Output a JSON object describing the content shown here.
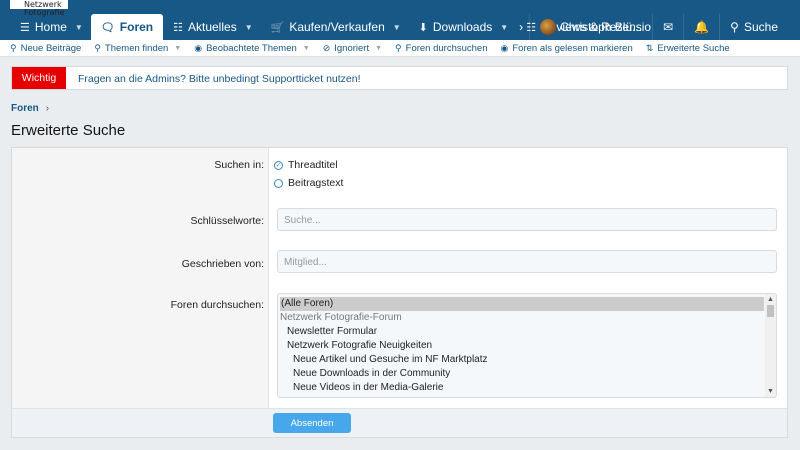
{
  "logo": {
    "text": "Netzwerk Fotografie"
  },
  "nav": {
    "items": [
      {
        "icon": "☰",
        "label": "Home"
      },
      {
        "icon": "🗨",
        "label": "Foren"
      },
      {
        "icon": "☷",
        "label": "Aktuelles"
      },
      {
        "icon": "🛒",
        "label": "Kaufen/Verkaufen"
      },
      {
        "icon": "⬇",
        "label": "Downloads"
      },
      {
        "icon": "☷",
        "label": "Reviews & Rezensio"
      }
    ],
    "more_arrow": "›",
    "user": "Christoph Blü...",
    "search_label": "Suche"
  },
  "subnav": {
    "items": [
      {
        "icon": "⚲",
        "label": "Neue Beiträge",
        "dropdown": false
      },
      {
        "icon": "⚲",
        "label": "Themen finden",
        "dropdown": true
      },
      {
        "icon": "◉",
        "label": "Beobachtete Themen",
        "dropdown": true
      },
      {
        "icon": "⊘",
        "label": "Ignoriert",
        "dropdown": true
      },
      {
        "icon": "⚲",
        "label": "Foren durchsuchen",
        "dropdown": false
      },
      {
        "icon": "◉",
        "label": "Foren als gelesen markieren",
        "dropdown": false
      },
      {
        "icon": "⇅",
        "label": "Erweiterte Suche",
        "dropdown": false
      }
    ]
  },
  "notice": {
    "badge": "Wichtig",
    "text": "Fragen an die Admins? Bitte unbedingt Supportticket nutzen!",
    "badge_color": "#e60000"
  },
  "breadcrumb": {
    "label": "Foren"
  },
  "page_title": "Erweiterte Suche",
  "form": {
    "search_in_label": "Suchen in:",
    "search_in_options": [
      {
        "label": "Threadtitel",
        "checked": true
      },
      {
        "label": "Beitragstext",
        "checked": false
      }
    ],
    "keywords_label": "Schlüsselworte:",
    "keywords_placeholder": "Suche...",
    "author_label": "Geschrieben von:",
    "author_placeholder": "Mitglied...",
    "forums_label": "Foren durchsuchen:",
    "forums_options": [
      {
        "label": "(Alle Foren)",
        "selected": true,
        "disabled": false
      },
      {
        "label": "Netzwerk Fotografie-Forum",
        "selected": false,
        "disabled": true
      },
      {
        "label": "Newsletter Formular",
        "selected": false,
        "disabled": false
      },
      {
        "label": "Netzwerk Fotografie Neuigkeiten",
        "selected": false,
        "disabled": false
      },
      {
        "label": "Neue Artikel und Gesuche im NF Marktplatz",
        "selected": false,
        "disabled": false
      },
      {
        "label": "Neue Downloads in der Community",
        "selected": false,
        "disabled": false
      },
      {
        "label": "Neue Videos in der Media-Galerie",
        "selected": false,
        "disabled": false
      }
    ],
    "submit_label": "Absenden"
  },
  "colors": {
    "header": "#185886",
    "accent": "#47a7eb",
    "link": "#185886"
  }
}
